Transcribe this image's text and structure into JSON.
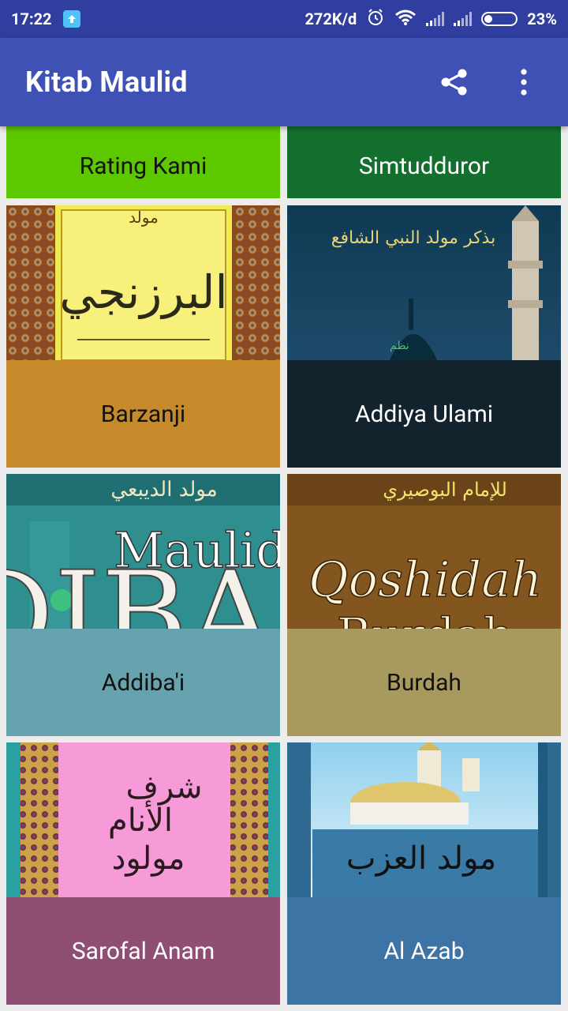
{
  "status_bar": {
    "time": "17:22",
    "net_speed": "272K/d",
    "battery": "23%"
  },
  "app_bar": {
    "title": "Kitab Maulid",
    "share_icon": "share-icon",
    "menu_icon": "more-vert-icon"
  },
  "top_row": [
    {
      "label": "Rating Kami",
      "color": "#5DC700"
    },
    {
      "label": "Simtudduror",
      "color": "#136F2E"
    }
  ],
  "cards": [
    {
      "label": "Barzanji",
      "color": "#C68A2A",
      "art_lines": [
        "مولد",
        "البرزنجي"
      ]
    },
    {
      "label": "Addiya Ulami",
      "color": "#12232E",
      "art_lines": [
        "بذكر مولد النبي الشافع",
        "نظم"
      ]
    },
    {
      "label": "Addiba'i",
      "color": "#67A3AE",
      "art_lines": [
        "مولد الديبعي",
        "Maulid",
        "DIBA'"
      ]
    },
    {
      "label": "Burdah",
      "color": "#A89A5E",
      "art_lines": [
        "للإمام البوصيري",
        "Qoshidah",
        "Burdah"
      ]
    },
    {
      "label": "Sarofal Anam",
      "color": "#8F4E74",
      "art_lines": [
        "شرف",
        "الأنام",
        "مولود"
      ]
    },
    {
      "label": "Al Azab",
      "color": "#3E73A6",
      "art_lines": [
        "مولد العزب"
      ]
    }
  ]
}
